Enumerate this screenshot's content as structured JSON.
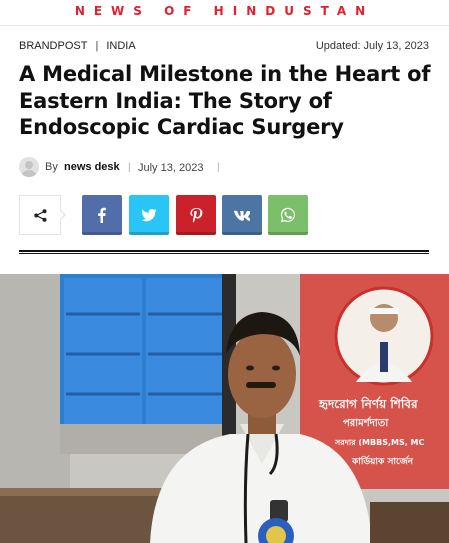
{
  "site": {
    "name": "NEWS OF HINDUSTAN"
  },
  "article": {
    "categories": [
      "BRANDPOST",
      "INDIA"
    ],
    "category_separator": "|",
    "updated": "Updated: July 13, 2023",
    "title": "A Medical Milestone in the Heart of Eastern India: The Story of Endoscopic Cardiac Surgery",
    "byline": {
      "by_label": "By",
      "author": "news desk",
      "separator": "|",
      "date": "July 13, 2023"
    }
  },
  "share": {
    "toggle_icon": "share-icon",
    "buttons": [
      {
        "network": "facebook",
        "icon": "facebook-icon",
        "color": "#516eab"
      },
      {
        "network": "twitter",
        "icon": "twitter-icon",
        "color": "#29c5f6"
      },
      {
        "network": "pinterest",
        "icon": "pinterest-icon",
        "color": "#ca212a"
      },
      {
        "network": "vk",
        "icon": "vk-icon",
        "color": "#4c75a3"
      },
      {
        "network": "whatsapp",
        "icon": "whatsapp-icon",
        "color": "#7bbf6a"
      }
    ]
  },
  "featured_image": {
    "banner_lines": [
      "হৃদরোগ নির্ণয় শিবির",
      "পরামর্শদাতা",
      "সরদার (MBBS,MS, MC",
      "কার্ডিয়াক সার্জেন"
    ]
  },
  "colors": {
    "brand": "#e2202e",
    "text": "#111111",
    "muted": "#444444"
  }
}
